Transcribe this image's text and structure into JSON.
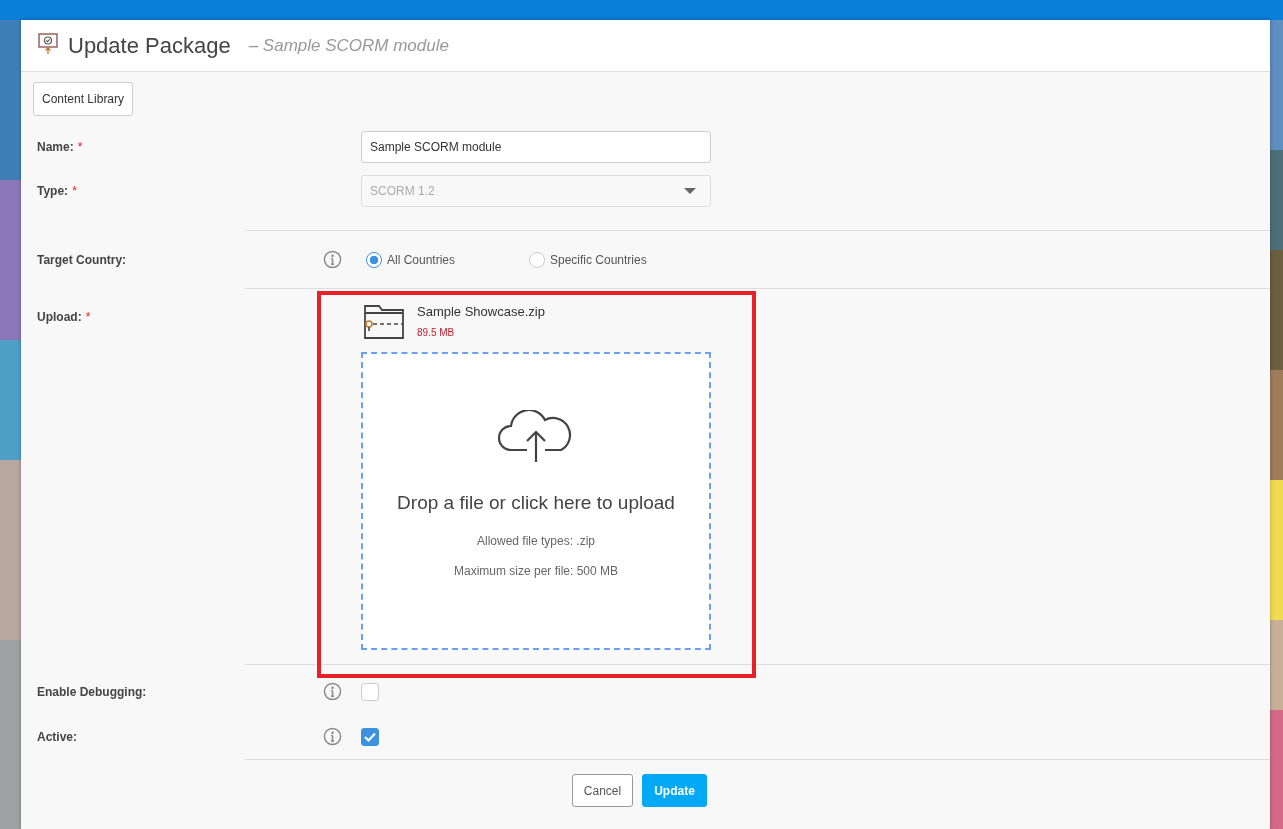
{
  "window": {
    "title": "Update Package",
    "subtitle": "– Sample SCORM module"
  },
  "toolbar": {
    "button": "Content Library"
  },
  "fields": [
    {
      "kind": "text",
      "label": "Name:",
      "required_mark": "*",
      "value": "Sample SCORM module",
      "divider_below": false
    },
    {
      "kind": "select",
      "label": "Type:",
      "required_mark": "*",
      "value": "SCORM 1.2",
      "disabled": true,
      "divider_below": true
    },
    {
      "kind": "radio",
      "label": "Target Country:",
      "info": true,
      "divider_below": true,
      "options": [
        {
          "label": "All Countries",
          "selected": true
        },
        {
          "label": "Specific Countries",
          "selected": false
        }
      ]
    },
    {
      "kind": "upload",
      "label": "Upload:",
      "required_mark": "*",
      "highlighted": true,
      "divider_below": true,
      "file": {
        "name": "Sample Showcase.zip",
        "size": "89.5 MB"
      },
      "dropzone": {
        "title": "Drop a file or click here to upload",
        "allowed": "Allowed file types: .zip",
        "max": "Maximum size per file: 500 MB"
      }
    },
    {
      "kind": "checkbox",
      "label": "Enable Debugging:",
      "info": true,
      "checked": false,
      "divider_below": false
    },
    {
      "kind": "checkbox",
      "label": "Active:",
      "info": true,
      "checked": true,
      "divider_below": true
    }
  ],
  "buttons": [
    {
      "label": "Cancel",
      "kind": "secondary"
    },
    {
      "label": "Update",
      "kind": "primary"
    }
  ]
}
